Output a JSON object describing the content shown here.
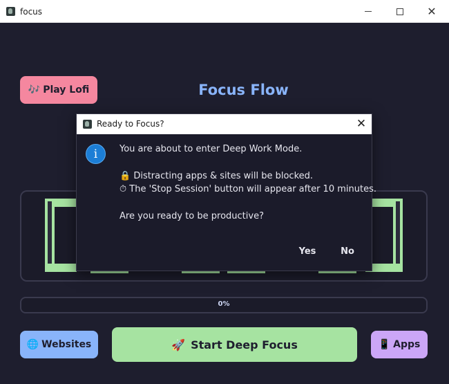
{
  "window": {
    "title": "focus",
    "icon": "app-logo-icon"
  },
  "app": {
    "title": "Focus Flow",
    "lofi_button": {
      "icon": "music-notes-icon",
      "glyph": "🎶",
      "label": "Play Lofi"
    },
    "progress": {
      "label": "0%",
      "value": 0
    },
    "websites_button": {
      "icon": "globe-icon",
      "glyph": "🌐",
      "label": "Websites"
    },
    "start_button": {
      "icon": "rocket-icon",
      "glyph": "🚀",
      "label": "Start Deep Focus"
    },
    "apps_button": {
      "icon": "phone-icon",
      "glyph": "📱",
      "label": "Apps"
    },
    "colors": {
      "background": "#1e1e2e",
      "accent_blue": "#89b4fa",
      "accent_green": "#a6e3a1",
      "accent_pink": "#f5879f",
      "accent_purple": "#cba6f7"
    }
  },
  "dialog": {
    "title": "Ready to Focus?",
    "icon": "info-icon",
    "line1": "You are about to enter Deep Work Mode.",
    "line2": "🔒 Distracting apps & sites will be blocked.",
    "line3": "⏱ The 'Stop Session' button will appear after 10 minutes.",
    "line4": "Are you ready to be productive?",
    "yes_label": "Yes",
    "no_label": "No"
  }
}
